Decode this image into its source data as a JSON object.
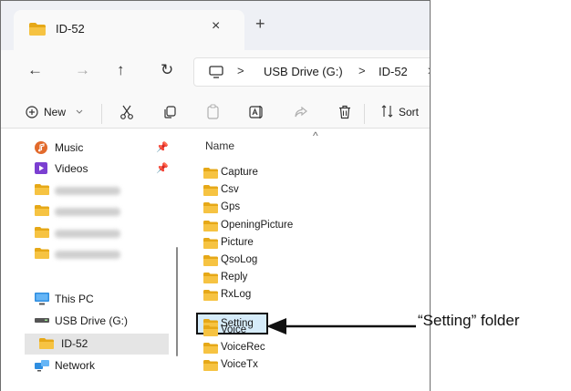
{
  "window": {
    "tab": {
      "title": "ID-52",
      "close_icon": "×",
      "new_tab_icon": "+"
    },
    "navigation": {
      "back": "←",
      "forward": "→",
      "up": "↑",
      "refresh": "↻"
    },
    "breadcrumb": {
      "crumbs": [
        "USB Drive (G:)",
        "ID-52"
      ],
      "separators": [
        ">",
        ">",
        ">"
      ]
    },
    "toolbar": {
      "new_label": "New",
      "sort_label": "Sort"
    },
    "sidebar": {
      "items": [
        {
          "label": "Music",
          "icon": "music-icon"
        },
        {
          "label": "Videos",
          "icon": "videos-icon"
        },
        {
          "label": "This PC",
          "icon": "pc-icon"
        },
        {
          "label": "USB Drive (G:)",
          "icon": "drive-icon"
        },
        {
          "label": "ID-52",
          "icon": "folder-icon"
        },
        {
          "label": "Network",
          "icon": "network-icon"
        }
      ],
      "selected": "ID-52"
    },
    "content": {
      "column_header": "Name",
      "files": [
        "Capture",
        "Csv",
        "Gps",
        "OpeningPicture",
        "Picture",
        "QsoLog",
        "Reply",
        "RxLog",
        "Setting",
        "Voice",
        "VoiceRec",
        "VoiceTx"
      ],
      "highlighted": "Setting"
    }
  },
  "callout": {
    "label": "“Setting” folder"
  },
  "colors": {
    "folder": "#f6c342",
    "folder_dark": "#e6a817",
    "accent": "#0067c0",
    "highlight_bg": "#d6ecfa"
  }
}
